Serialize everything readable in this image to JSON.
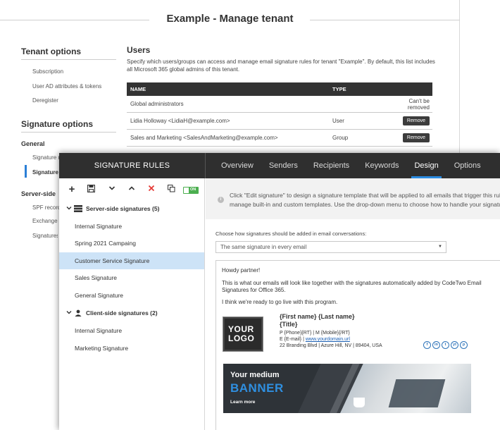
{
  "back_window": {
    "title": "Example - Manage tenant",
    "tenant_options": {
      "heading": "Tenant options",
      "links": [
        "Subscription",
        "User AD attributes & tokens",
        "Deregister"
      ]
    },
    "signature_options": {
      "heading": "Signature options",
      "general_heading": "General",
      "general_items": [
        "Signature r",
        "Signature"
      ],
      "server_side_heading": "Server-side",
      "server_side_items": [
        "SPF record",
        "Exchange O",
        "Signatures"
      ]
    },
    "users": {
      "heading": "Users",
      "description": "Specify which users/groups can access and manage email signature rules for tenant \"Example\". By default, this list includes all Microsoft 365 global admins of this tenant.",
      "columns": [
        "NAME",
        "TYPE"
      ],
      "rows": [
        {
          "name": "Global administrators",
          "type": "",
          "action": "Can't be removed"
        },
        {
          "name": "Lidia Holloway <LidiaH@example.com>",
          "type": "User",
          "action": "Remove"
        },
        {
          "name": "Sales and Marketing <SalesAndMarketing@example.com>",
          "type": "Group",
          "action": "Remove"
        }
      ]
    }
  },
  "front_window": {
    "title": "SIGNATURE RULES",
    "tabs": [
      {
        "label": "Overview",
        "active": false
      },
      {
        "label": "Senders",
        "active": false
      },
      {
        "label": "Recipients",
        "active": false
      },
      {
        "label": "Keywords",
        "active": false
      },
      {
        "label": "Design",
        "active": true
      },
      {
        "label": "Options",
        "active": false
      }
    ],
    "toolbar": {
      "icons": [
        "add-icon",
        "save-icon",
        "move-down-icon",
        "move-up-icon",
        "delete-icon",
        "copy-icon"
      ],
      "toggle_label": "ON"
    },
    "server_group": {
      "label": "Server-side signatures (5)",
      "items": [
        "Internal Signature",
        "Spring 2021 Campaing",
        "Customer Service Signature",
        "Sales Signature",
        "General Signature"
      ],
      "selected_index": 2
    },
    "client_group": {
      "label": "Client-side signatures (2)",
      "items": [
        "Internal Signature",
        "Marketing Signature"
      ]
    },
    "info_text_line1": "Click \"Edit signature\" to design a signature template that will be applied to all emails that trigger this rule.",
    "info_text_line2": "manage built-in and custom templates. Use the drop-down menu to choose how to handle your signature",
    "choose_label": "Choose how signatures should be added in email conversations:",
    "choose_value": "The same signature in every email",
    "preview": {
      "greeting": "Howdy partner!",
      "body_line1": "This is what our emails will look like together with the signatures automatically added by CodeTwo Email",
      "body_line2": "Signatures for Office 365.",
      "closing": "I think we're ready to go live with this program.",
      "logo_line1": "YOUR",
      "logo_line2": "LOGO",
      "sig_name": "{First name} {Last name}",
      "sig_title": "{Title}",
      "sig_phone": "P {Phone}{RT} | M {Mobile}{/RT}",
      "sig_email_prefix": "E {E-mail} | ",
      "sig_url": "www.yourdomain.url",
      "sig_address": "22 Branding Blvd | Azure Hill, NV | 89404, USA",
      "social": [
        "f",
        "in",
        "t",
        "yt",
        "p"
      ],
      "banner_line1": "Your medium",
      "banner_line2": "BANNER",
      "banner_line3": "Learn more"
    }
  },
  "colors": {
    "accent": "#2b8be0",
    "topbar": "#2f2f2f",
    "selected_row": "#cde3f7",
    "toggle_on": "#4caf50",
    "delete_red": "#e53935"
  }
}
